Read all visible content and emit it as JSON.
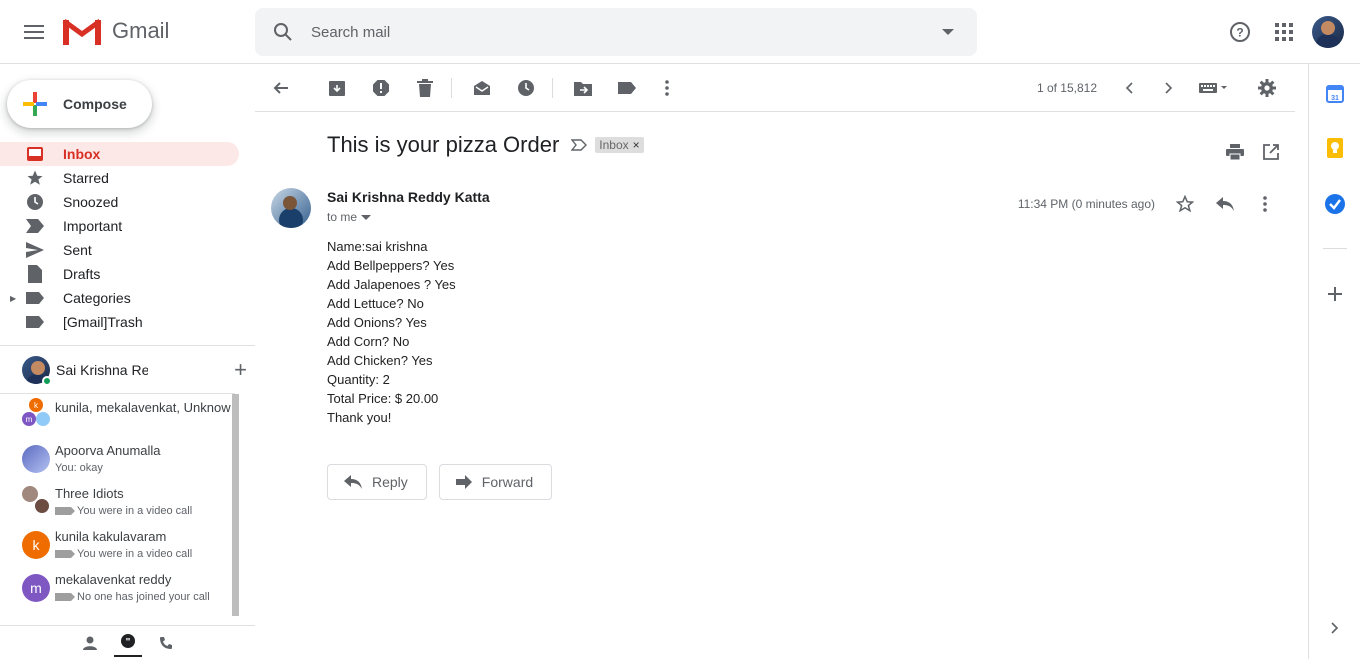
{
  "app": {
    "logo_text": "Gmail"
  },
  "search": {
    "placeholder": "Search mail"
  },
  "compose": {
    "label": "Compose"
  },
  "nav": [
    {
      "label": "Inbox",
      "icon": "inbox-icon",
      "active": true
    },
    {
      "label": "Starred",
      "icon": "star-icon"
    },
    {
      "label": "Snoozed",
      "icon": "clock-icon"
    },
    {
      "label": "Important",
      "icon": "important-icon"
    },
    {
      "label": "Sent",
      "icon": "send-icon"
    },
    {
      "label": "Drafts",
      "icon": "draft-icon"
    },
    {
      "label": "Categories",
      "icon": "label-icon"
    },
    {
      "label": "[Gmail]Trash",
      "icon": "label-icon"
    }
  ],
  "hangouts": {
    "user_name": "Sai Krishna Red",
    "items": [
      {
        "title": "kunila, mekalavenkat, Unknow",
        "subtitle": "",
        "avatar_letter": "",
        "color": "#ef6c00"
      },
      {
        "title": "Apoorva Anumalla",
        "subtitle": "You: okay",
        "avatar_letter": "",
        "color": "#6a7fd6"
      },
      {
        "title": "Three Idiots",
        "subtitle": "You were in a video call",
        "avatar_letter": "",
        "color": "#8d6e63"
      },
      {
        "title": "kunila kakulavaram",
        "subtitle": "You were in a video call",
        "avatar_letter": "k",
        "color": "#ef6c00"
      },
      {
        "title": "mekalavenkat reddy",
        "subtitle": "No one has joined your call",
        "avatar_letter": "m",
        "color": "#7e57c2"
      }
    ]
  },
  "toolbar": {
    "count": "1 of 15,812"
  },
  "email": {
    "subject": "This is your pizza Order",
    "label": "Inbox",
    "sender": "Sai Krishna Reddy Katta",
    "to": "to me",
    "time": "11:34 PM (0 minutes ago)",
    "body": [
      "Name:sai krishna",
      "Add Bellpeppers? Yes",
      "Add Jalapenoes ? Yes",
      "Add Lettuce? No",
      "Add Onions? Yes",
      "Add Corn? No",
      "Add Chicken? Yes",
      "Quantity: 2",
      "Total Price: $ 20.00",
      "Thank you!"
    ],
    "reply_label": "Reply",
    "forward_label": "Forward"
  },
  "colors": {
    "accent": "#d93025",
    "active_bg": "#fce8e6"
  }
}
